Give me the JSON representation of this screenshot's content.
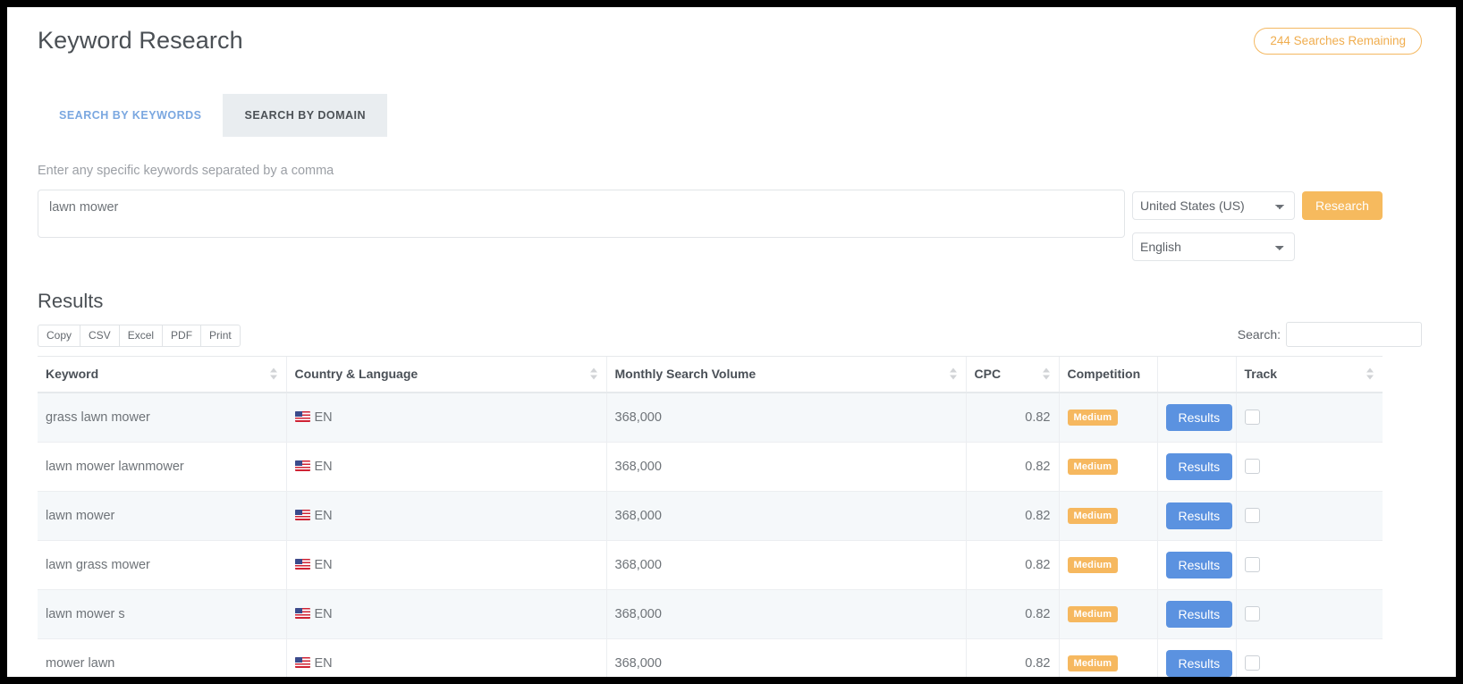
{
  "header": {
    "title": "Keyword Research",
    "searches_badge": "244 Searches Remaining",
    "badge_color": "#f0ad4e"
  },
  "tabs": [
    {
      "label": "SEARCH BY KEYWORDS",
      "active": false
    },
    {
      "label": "SEARCH BY DOMAIN",
      "active": true
    }
  ],
  "form": {
    "hint": "Enter any specific keywords separated by a comma",
    "keywords_value": "lawn mower",
    "keywords_placeholder": "",
    "country_selected": "United States (US)",
    "country_options": [
      "United States (US)"
    ],
    "language_selected": "English",
    "language_options": [
      "English"
    ],
    "research_button": "Research",
    "research_button_color": "#f6ba5e"
  },
  "results": {
    "title": "Results",
    "export_buttons": [
      "Copy",
      "CSV",
      "Excel",
      "PDF",
      "Print"
    ],
    "search_label": "Search:",
    "search_value": "",
    "columns": [
      {
        "label": "Keyword",
        "sortable": true
      },
      {
        "label": "Country & Language",
        "sortable": true
      },
      {
        "label": "Monthly Search Volume",
        "sortable": true
      },
      {
        "label": "CPC",
        "sortable": true
      },
      {
        "label": "Competition",
        "sortable": false
      },
      {
        "label": "",
        "sortable": false
      },
      {
        "label": "Track",
        "sortable": true
      }
    ],
    "row_action_label": "Results",
    "row_action_color": "#5b92e0",
    "competition_badge_color": "#f6b85f",
    "rows": [
      {
        "keyword": "grass lawn mower",
        "flag": "us-flag-icon",
        "language": "EN",
        "volume": "368,000",
        "cpc": "0.82",
        "competition": "Medium",
        "tracked": false
      },
      {
        "keyword": "lawn mower lawnmower",
        "flag": "us-flag-icon",
        "language": "EN",
        "volume": "368,000",
        "cpc": "0.82",
        "competition": "Medium",
        "tracked": false
      },
      {
        "keyword": "lawn mower",
        "flag": "us-flag-icon",
        "language": "EN",
        "volume": "368,000",
        "cpc": "0.82",
        "competition": "Medium",
        "tracked": false
      },
      {
        "keyword": "lawn grass mower",
        "flag": "us-flag-icon",
        "language": "EN",
        "volume": "368,000",
        "cpc": "0.82",
        "competition": "Medium",
        "tracked": false
      },
      {
        "keyword": "lawn mower s",
        "flag": "us-flag-icon",
        "language": "EN",
        "volume": "368,000",
        "cpc": "0.82",
        "competition": "Medium",
        "tracked": false
      },
      {
        "keyword": "mower lawn",
        "flag": "us-flag-icon",
        "language": "EN",
        "volume": "368,000",
        "cpc": "0.82",
        "competition": "Medium",
        "tracked": false
      }
    ]
  }
}
